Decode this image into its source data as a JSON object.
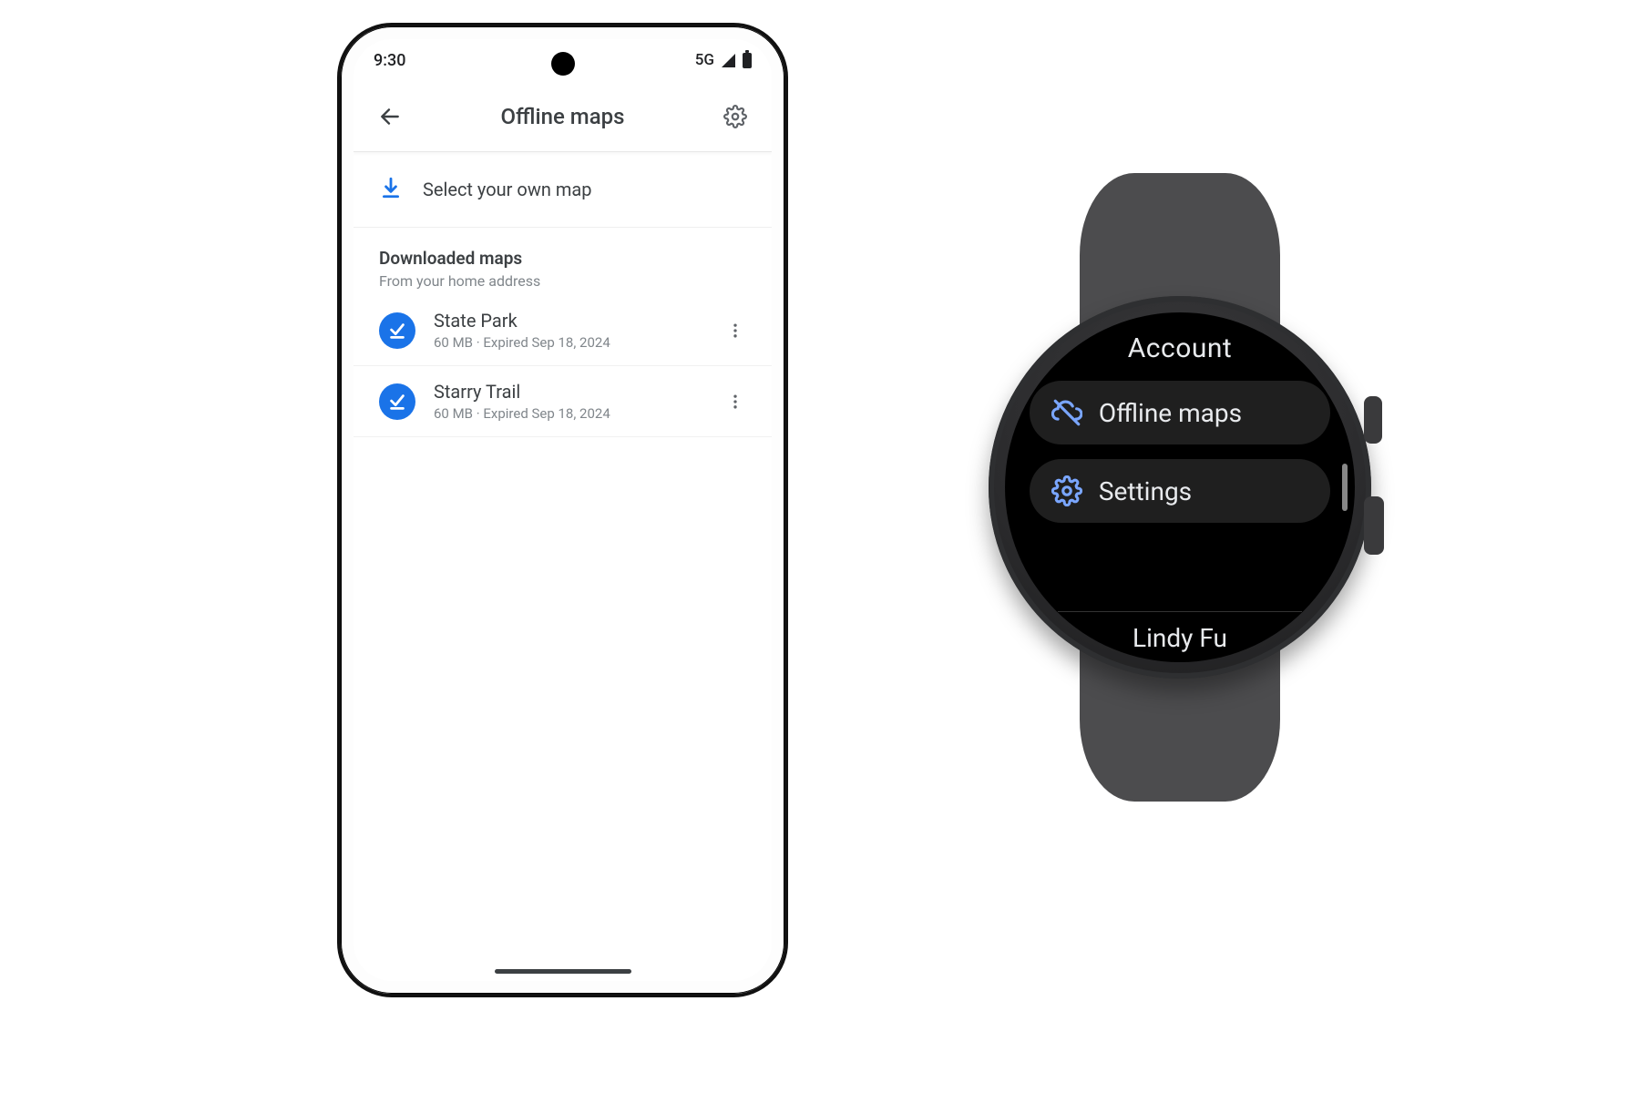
{
  "phone": {
    "status": {
      "time": "9:30",
      "network": "5G"
    },
    "appbar": {
      "title": "Offline maps"
    },
    "select_row": {
      "label": "Select your own map"
    },
    "section": {
      "heading": "Downloaded maps",
      "sub": "From your home address"
    },
    "maps": [
      {
        "name": "State Park",
        "meta": "60 MB · Expired Sep 18, 2024"
      },
      {
        "name": "Starry Trail",
        "meta": "60 MB · Expired Sep 18, 2024"
      }
    ]
  },
  "watch": {
    "heading": "Account",
    "items": [
      {
        "icon": "cloud-off",
        "label": "Offline maps"
      },
      {
        "icon": "gear",
        "label": "Settings"
      }
    ],
    "footer": "Lindy Fu"
  },
  "colors": {
    "accent": "#1a73e8"
  }
}
